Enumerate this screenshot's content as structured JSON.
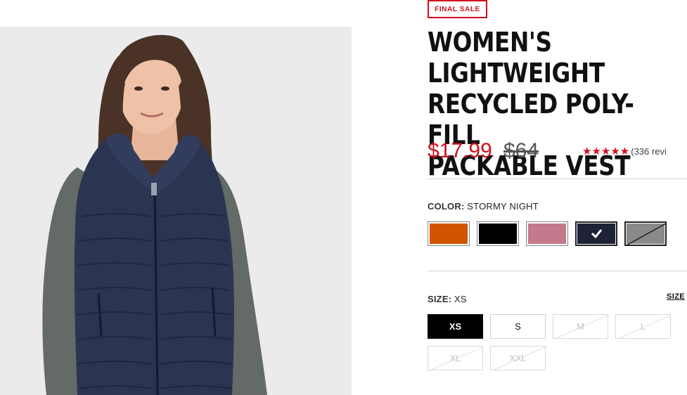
{
  "product": {
    "badge": "FINAL SALE",
    "title": "WOMEN'S LIGHTWEIGHT\nRECYCLED POLY-FILL\nPACKABLE VEST",
    "price_sale": "$17.99",
    "price_original": "$64",
    "rating_stars": "★★★★★",
    "reviews_text": "(336 revi"
  },
  "color": {
    "label": "COLOR:",
    "value": "STORMY NIGHT",
    "swatches": [
      {
        "name": "orange",
        "color": "#d35400"
      },
      {
        "name": "black",
        "color": "#000000"
      },
      {
        "name": "rose",
        "color": "#c47a8c"
      },
      {
        "name": "stormy-night",
        "color": "#1d2237",
        "selected": true
      },
      {
        "name": "grey",
        "color": "#8a8a8a",
        "unavailable": true
      }
    ]
  },
  "size": {
    "label": "SIZE:",
    "value": "XS",
    "guide_label": "SIZE",
    "options": [
      {
        "label": "XS",
        "state": "selected"
      },
      {
        "label": "S",
        "state": "available"
      },
      {
        "label": "M",
        "state": "unavailable"
      },
      {
        "label": "L",
        "state": "unavailable"
      },
      {
        "label": "XL",
        "state": "unavailable"
      },
      {
        "label": "XXL",
        "state": "unavailable"
      }
    ]
  },
  "colors": {
    "accent": "#d0101b",
    "image_background": "#ebebeb",
    "vest": "#2b3450",
    "sleeve": "#646b66"
  }
}
